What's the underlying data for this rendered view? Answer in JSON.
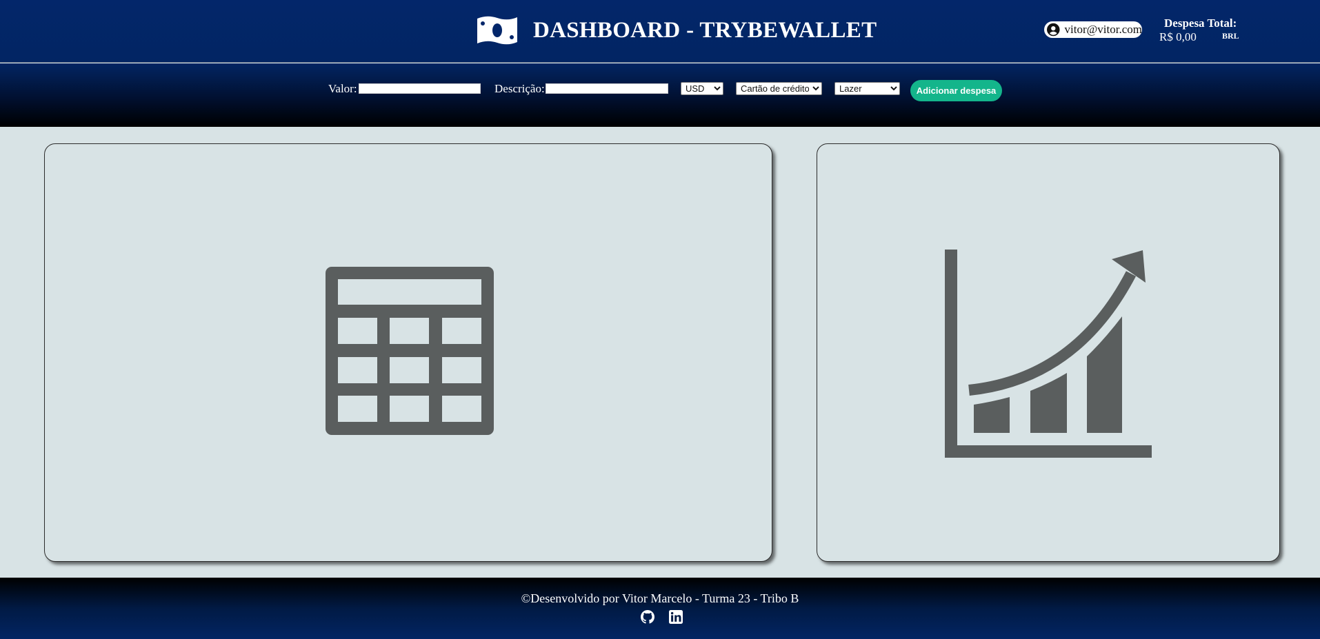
{
  "header": {
    "title": "DASHBOARD - TRYBEWALLET",
    "user_email": "vitor@vitor.com",
    "total_label": "Despesa Total:",
    "total_value": "R$ 0,00",
    "total_currency": "BRL"
  },
  "form": {
    "value_label": "Valor:",
    "value_input": "",
    "description_label": "Descrição:",
    "description_input": "",
    "currency_selected": "USD",
    "method_selected": "Cartão de crédito",
    "tag_selected": "Lazer",
    "submit_label": "Adicionar despesa"
  },
  "main": {
    "table_card_icon": "table-grid-icon",
    "chart_card_icon": "chart-line-up-icon"
  },
  "footer": {
    "credit": "©Desenvolvido por Vitor Marcelo - Turma 23 - Tribo B",
    "links": [
      {
        "icon": "github-icon"
      },
      {
        "icon": "linkedin-icon"
      }
    ]
  },
  "colors": {
    "header_blue": "#03266a",
    "accent_green": "#14b58b",
    "page_bg": "#d8e3e5",
    "icon_gray": "#5a5e5e"
  }
}
